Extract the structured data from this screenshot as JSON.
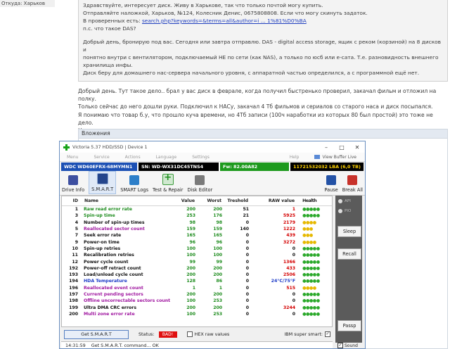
{
  "from": "Откуда: Харьков",
  "quote": {
    "lines": [
      "Здравствуйте, интересует диск. Живу в Харькове, так что только почтой могу купить.",
      "Отправляйте наложкой, Харьков, №124, Колесник Денис, 0675808808. Если что могу скинуть задаток."
    ],
    "link_prefix": "В проверенных есть: ",
    "link_text": "search.php?keywords=&terms=all&author=i ... 1%81%D0%BA",
    "question": "п.с. что такое DAS?",
    "reply": [
      "Добрый день, бронирую под вас. Сегодня или завтра отправлю. DAS - digital access storage, ящик с реком (корзиной) на 8 дисков и",
      "понятно внутри с вентилятором, подключаемый НЕ по сети (как NAS), а только по юсб или е-сата. Т.е. разновидность внешнего",
      "хранилища инфы.",
      "Диск беру для домашнего нас-сервера начального уровня, с аппаратной частью определился, а с программной ещё нет."
    ]
  },
  "post": [
    "Добрый день. Тут такое дело.. брал у вас диск в феврале, когда получил быстренько проверил, закачал фильм и отложил на полку.",
    "Только сейчас до него дошли руки. Подключил к НАСу, закачал 4 Тб фильмов и сериалов со старого наса и диск посыпался.",
    "Я понимаю что товар б.у, что прошло куча времени, но 4Тб записи (100ч наработки из которых 80 был простой) это тоже не дело.",
    "Надо что-то решать с этим."
  ],
  "attachments_title": "Вложения",
  "victoria": {
    "title": "Victoria 5.37 HDD/SSD | Device 1",
    "menu": [
      "Menu",
      "Service",
      "Actions",
      "Language",
      "Settings",
      "Help"
    ],
    "view_buffer": "View Buffer Live",
    "model": "WDC WD60EFRX-68MYMN1",
    "sn": "SN: WD-WX31DC45TNS4",
    "fw": "Fw: 82.00A82",
    "lba": "11721532032 LBA (6,0 TB)",
    "toolbar": {
      "drive_info": "Drive Info",
      "smart": "S.M.A.R.T",
      "smart_logs": "SMART Logs",
      "test_repair": "Test & Repair",
      "disk_editor": "Disk Editor",
      "pause": "Pause",
      "break_all": "Break All"
    },
    "columns": [
      "ID",
      "Name",
      "Value",
      "Worst",
      "Treshold",
      "RAW value",
      "Health"
    ],
    "rows": [
      {
        "id": "1",
        "name": "Raw read error rate",
        "value": "200",
        "worst": "200",
        "thr": "51",
        "raw": "1",
        "health": "●●●●●",
        "nc": "n-grn",
        "vc": "v-grn",
        "rc": "r-red",
        "hc": "h-g"
      },
      {
        "id": "3",
        "name": "Spin-up time",
        "value": "253",
        "worst": "176",
        "thr": "21",
        "raw": "5925",
        "health": "●●●●●",
        "nc": "n-grn",
        "vc": "v-grn",
        "rc": "r-red",
        "hc": "h-g"
      },
      {
        "id": "4",
        "name": "Number of spin-up times",
        "value": "98",
        "worst": "98",
        "thr": "0",
        "raw": "2179",
        "health": "●●●●",
        "nc": "n-blk",
        "vc": "v-grn",
        "rc": "r-red",
        "hc": "h-y"
      },
      {
        "id": "5",
        "name": "Reallocated sector count",
        "value": "159",
        "worst": "159",
        "thr": "140",
        "raw": "1222",
        "health": "●●●",
        "nc": "n-prp",
        "vc": "v-grn",
        "rc": "r-red",
        "hc": "h-y"
      },
      {
        "id": "7",
        "name": "Seek error rate",
        "value": "165",
        "worst": "165",
        "thr": "0",
        "raw": "439",
        "health": "●●●",
        "nc": "n-blk",
        "vc": "v-grn",
        "rc": "r-red",
        "hc": "h-y"
      },
      {
        "id": "9",
        "name": "Power-on time",
        "value": "96",
        "worst": "96",
        "thr": "0",
        "raw": "3272",
        "health": "●●●●",
        "nc": "n-blk",
        "vc": "v-grn",
        "rc": "r-red",
        "hc": "h-y"
      },
      {
        "id": "10",
        "name": "Spin-up retries",
        "value": "100",
        "worst": "100",
        "thr": "0",
        "raw": "0",
        "health": "●●●●●",
        "nc": "n-blk",
        "vc": "v-grn",
        "rc": "r-dk",
        "hc": "h-g"
      },
      {
        "id": "11",
        "name": "Recalibration retries",
        "value": "100",
        "worst": "100",
        "thr": "0",
        "raw": "0",
        "health": "●●●●●",
        "nc": "n-blk",
        "vc": "v-grn",
        "rc": "r-dk",
        "hc": "h-g"
      },
      {
        "id": "12",
        "name": "Power cycle count",
        "value": "99",
        "worst": "99",
        "thr": "0",
        "raw": "1366",
        "health": "●●●●●",
        "nc": "n-blk",
        "vc": "v-grn",
        "rc": "r-red",
        "hc": "h-g"
      },
      {
        "id": "192",
        "name": "Power-off retract count",
        "value": "200",
        "worst": "200",
        "thr": "0",
        "raw": "433",
        "health": "●●●●●",
        "nc": "n-blk",
        "vc": "v-grn",
        "rc": "r-red",
        "hc": "h-g"
      },
      {
        "id": "193",
        "name": "Load/unload cycle count",
        "value": "200",
        "worst": "200",
        "thr": "0",
        "raw": "2506",
        "health": "●●●●●",
        "nc": "n-blk",
        "vc": "v-grn",
        "rc": "r-red",
        "hc": "h-g"
      },
      {
        "id": "194",
        "name": "HDA Temperature",
        "value": "128",
        "worst": "86",
        "thr": "0",
        "raw": "24°C/75°F",
        "health": "●●●●●",
        "nc": "n-blu",
        "vc": "v-grn",
        "rc": "r-blu",
        "hc": "h-g"
      },
      {
        "id": "196",
        "name": "Reallocated event count",
        "value": "1",
        "worst": "1",
        "thr": "0",
        "raw": "515",
        "health": "●●●●",
        "nc": "n-prp",
        "vc": "v-grn",
        "rc": "r-red",
        "hc": "h-y"
      },
      {
        "id": "197",
        "name": "Current pending sectors",
        "value": "200",
        "worst": "200",
        "thr": "0",
        "raw": "0",
        "health": "●●●●●",
        "nc": "n-prp",
        "vc": "v-grn",
        "rc": "r-dk",
        "hc": "h-g"
      },
      {
        "id": "198",
        "name": "Offline uncorrectable sectors count",
        "value": "100",
        "worst": "253",
        "thr": "0",
        "raw": "0",
        "health": "●●●●●",
        "nc": "n-prp",
        "vc": "v-grn",
        "rc": "r-dk",
        "hc": "h-g"
      },
      {
        "id": "199",
        "name": "Ultra DMA CRC errors",
        "value": "200",
        "worst": "200",
        "thr": "0",
        "raw": "3244",
        "health": "●●●●●",
        "nc": "n-blk",
        "vc": "v-grn",
        "rc": "r-red",
        "hc": "h-g"
      },
      {
        "id": "200",
        "name": "Multi zone error rate",
        "value": "100",
        "worst": "253",
        "thr": "0",
        "raw": "0",
        "health": "●●●●●",
        "nc": "n-prp",
        "vc": "v-grn",
        "rc": "r-dk",
        "hc": "h-g"
      }
    ],
    "side": {
      "api": "API",
      "pio": "PIO",
      "sleep": "Sleep",
      "recall": "Recall",
      "passp": "Passp",
      "sound": "Sound"
    },
    "bottom": {
      "get_smart": "Get S.M.A.R.T",
      "status_label": "Status:",
      "status_value": "BAD!",
      "hex_raw": "HEX raw values",
      "ibm": "IBM super smart:"
    },
    "log": {
      "time": "14:31:59",
      "text": "Get S.M.A.R.T. command... OK"
    }
  },
  "colors": {
    "status_bad": "#e01010",
    "model_bg": "#1c50b4",
    "fw_bg": "#1e9a1e",
    "lba_fg": "#ffd200"
  }
}
